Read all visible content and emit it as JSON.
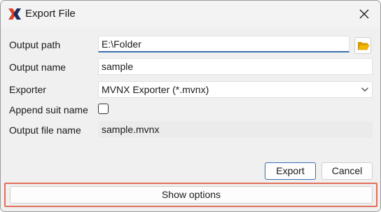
{
  "window": {
    "title": "Export File",
    "app_icon": "xsens-x-logo",
    "close_icon": "close-icon"
  },
  "form": {
    "output_path": {
      "label": "Output path",
      "value": "E:\\Folder",
      "browse_icon": "folder-open-icon"
    },
    "output_name": {
      "label": "Output name",
      "value": "sample"
    },
    "exporter": {
      "label": "Exporter",
      "value": "MVNX Exporter (*.mvnx)",
      "dropdown_icon": "chevron-down-icon"
    },
    "append_suit_name": {
      "label": "Append suit name",
      "checked": false
    },
    "output_file_name": {
      "label": "Output file name",
      "value": "sample.mvnx"
    }
  },
  "buttons": {
    "export": "Export",
    "cancel": "Cancel",
    "show_options": "Show options"
  },
  "colors": {
    "accent": "#3c6fb0",
    "highlight": "#e0705a",
    "logo_red": "#e0412b",
    "logo_dark": "#1b2d5c",
    "folder": "#f2b705"
  }
}
